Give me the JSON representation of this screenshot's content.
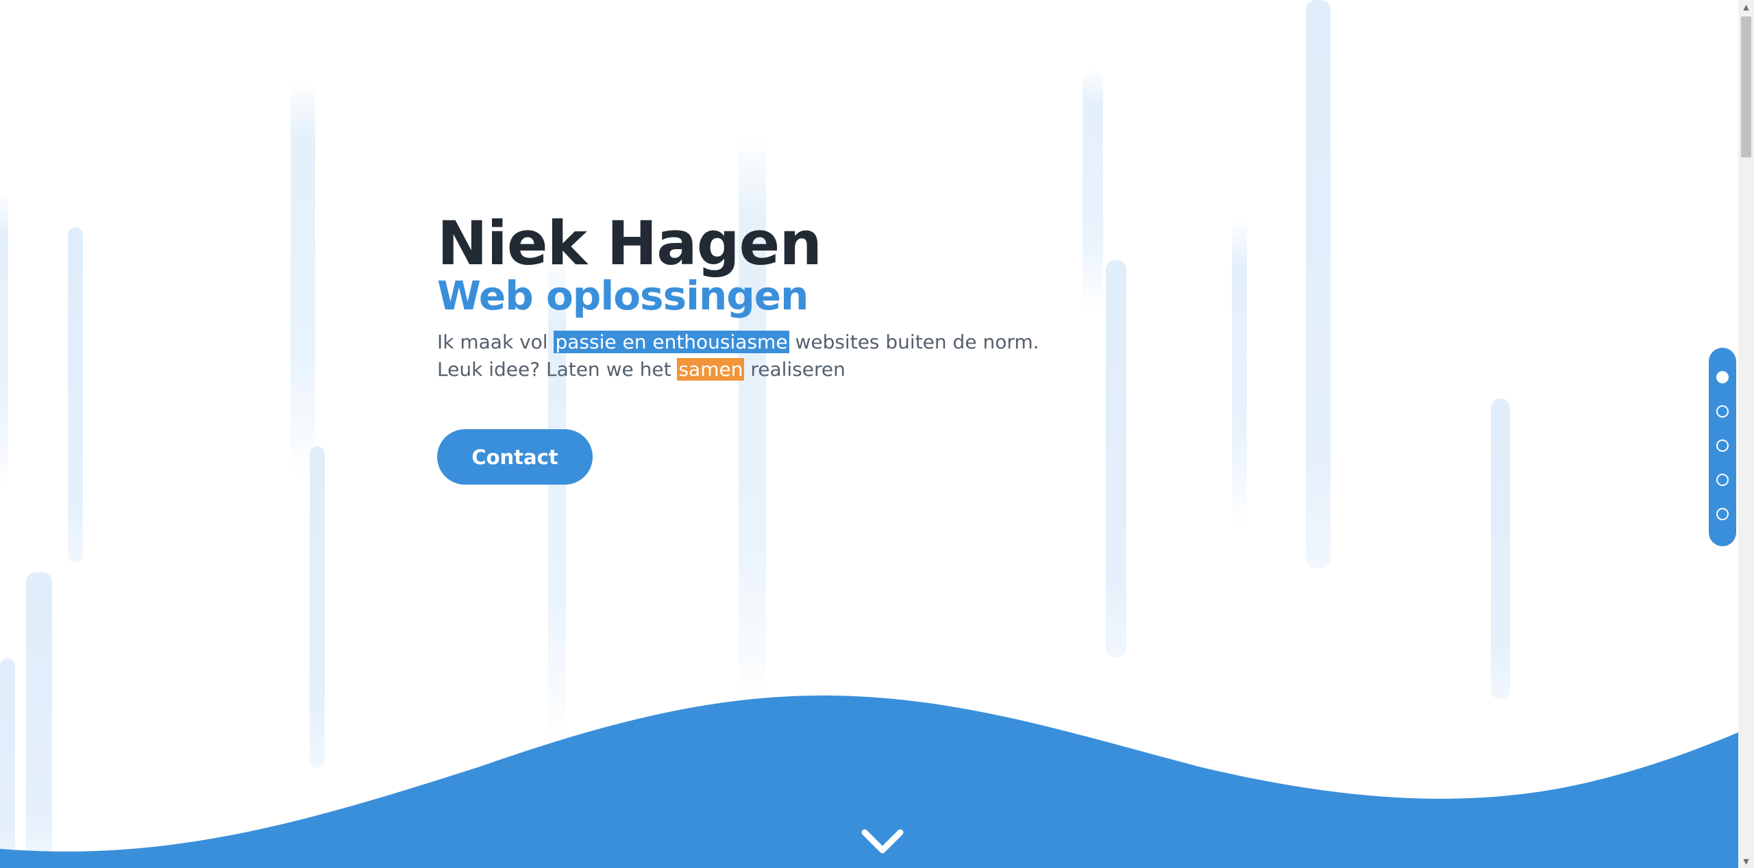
{
  "hero": {
    "name": "Niek Hagen",
    "subtitle": "Web oplossingen",
    "text_part1": "Ik maak vol ",
    "highlight_blue": "passie en enthousiasme",
    "text_part2": " websites buiten de norm.",
    "text_part3": "Leuk idee? Laten we het ",
    "highlight_orange": "samen",
    "text_part4": " realiseren",
    "contact_label": "Contact"
  },
  "section_nav": {
    "dots": [
      "section-1",
      "section-2",
      "section-3",
      "section-4",
      "section-5"
    ],
    "active_index": 0
  },
  "scroll_down": {
    "icon": "chevron-down-icon"
  },
  "scrollbar": {
    "up_icon": "▲",
    "down_icon": "▼"
  },
  "colors": {
    "primary": "#3a8fda",
    "accent": "#f0953a",
    "heading": "#222a33",
    "body_text": "#55606c"
  }
}
